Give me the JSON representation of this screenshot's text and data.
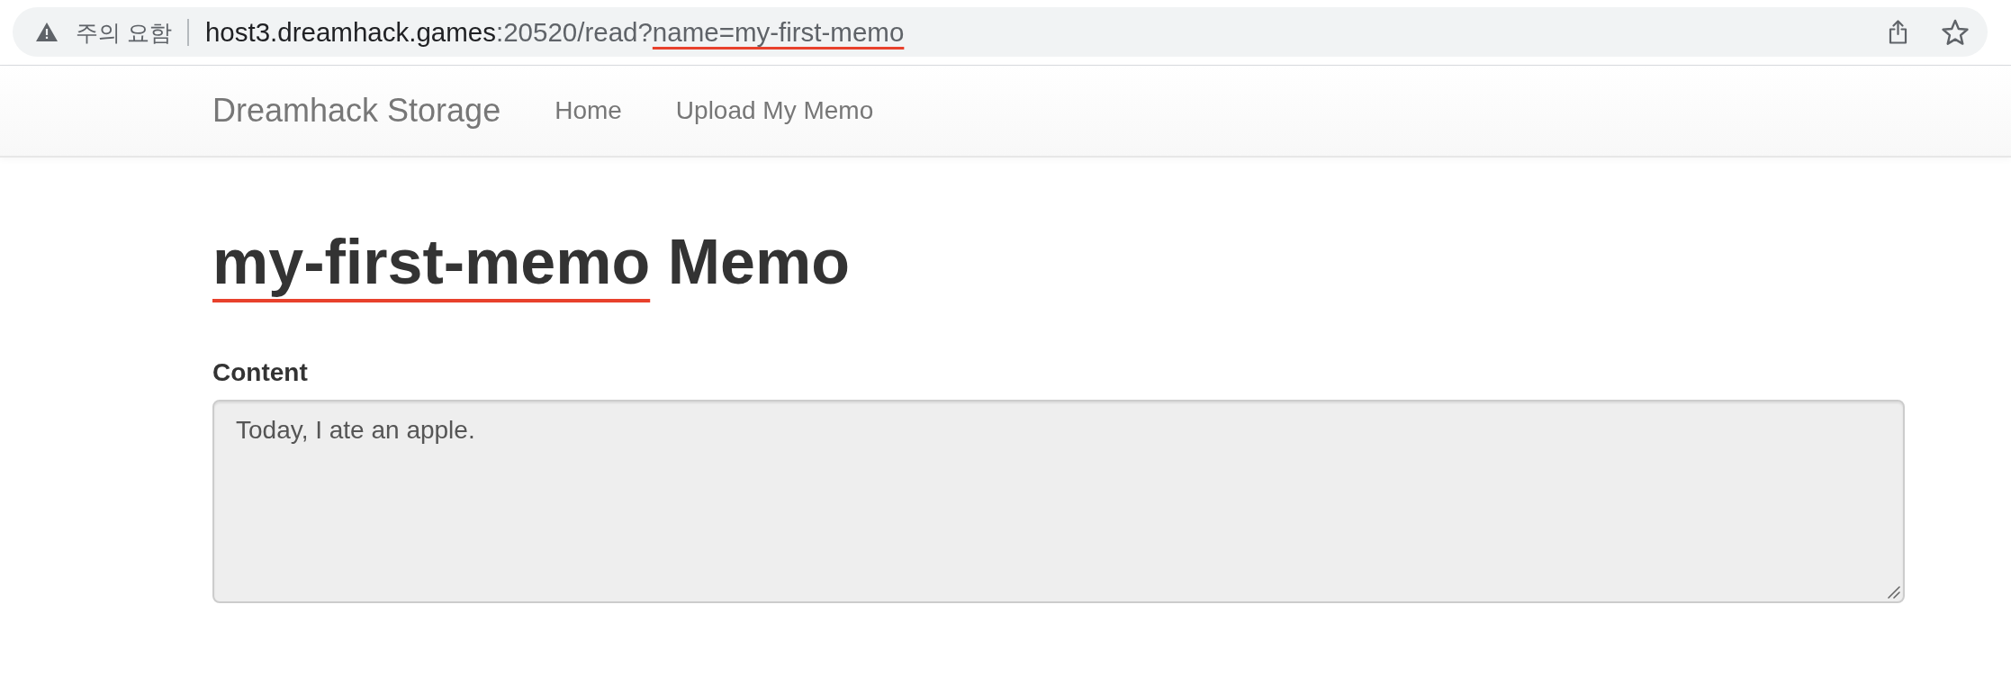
{
  "browser": {
    "security_label": "주의 요함",
    "url": {
      "host": "host3.dreamhack.games",
      "path": ":20520/read?",
      "query": "name=my-first-memo",
      "query_underlined": true
    },
    "bookmarked": false
  },
  "navbar": {
    "brand": "Dreamhack Storage",
    "links": [
      {
        "label": "Home",
        "selected": false
      },
      {
        "label": "Upload My Memo",
        "selected": false
      }
    ]
  },
  "memo": {
    "name": "my-first-memo",
    "title_suffix": "Memo",
    "name_underlined": true,
    "content": {
      "label": "Content",
      "value": "Today, I ate an apple.",
      "readonly": true
    }
  }
}
